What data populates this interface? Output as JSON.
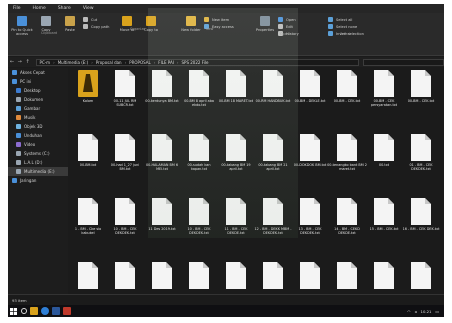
{
  "ribbon_tabs": [
    "File",
    "Home",
    "Share",
    "View"
  ],
  "ribbon": {
    "clipboard": {
      "pin": "Pin to Quick access",
      "copy": "Copy",
      "paste": "Paste",
      "cut": "Cut",
      "copy_path": "Copy path",
      "paste_shortcut": "Paste shortcut",
      "group": "Clipboard"
    },
    "organize": {
      "move_to": "Move to",
      "copy_to": "Copy to",
      "delete": "Delete",
      "rename": "Rename",
      "group": "Organize"
    },
    "new": {
      "new_folder": "New folder",
      "new_item": "New item",
      "easy_access": "Easy access",
      "group": "New"
    },
    "open": {
      "properties": "Properties",
      "open": "Open",
      "edit": "Edit",
      "history": "History",
      "group": "Open"
    },
    "select": {
      "select_all": "Select all",
      "select_none": "Select none",
      "invert": "Invert selection",
      "group": "Select"
    }
  },
  "address": {
    "crumbs": [
      "PC-m",
      "Multimedia (E:)",
      "Proposal dan",
      "PROPOSAL",
      "FILE PAI",
      "SPS 2022 File"
    ]
  },
  "sidebar": [
    {
      "label": "Akses Cepat",
      "sel": false,
      "indent": false,
      "color": "#4a90d9"
    },
    {
      "label": "PC ini",
      "sel": false,
      "indent": false,
      "color": "#4a90d9"
    },
    {
      "label": "Desktop",
      "sel": false,
      "indent": true,
      "color": "#3c7bd0"
    },
    {
      "label": "Dokumen",
      "sel": false,
      "indent": true,
      "color": "#9aa6b2"
    },
    {
      "label": "Gambar",
      "sel": false,
      "indent": true,
      "color": "#5ca0d8"
    },
    {
      "label": "Musik",
      "sel": false,
      "indent": true,
      "color": "#e08a3c"
    },
    {
      "label": "Objek 3D",
      "sel": false,
      "indent": true,
      "color": "#6fb3e0"
    },
    {
      "label": "Unduhan",
      "sel": false,
      "indent": true,
      "color": "#4a90d9"
    },
    {
      "label": "Video",
      "sel": false,
      "indent": true,
      "color": "#8c6cd0"
    },
    {
      "label": "Systems (C:)",
      "sel": false,
      "indent": true,
      "color": "#9aa6b2"
    },
    {
      "label": "L.A.L (D:)",
      "sel": false,
      "indent": true,
      "color": "#9aa6b2"
    },
    {
      "label": "Multimedia (E:)",
      "sel": true,
      "indent": true,
      "color": "#9aa6b2"
    },
    {
      "label": "Jaringan",
      "sel": false,
      "indent": false,
      "color": "#4a90d9"
    }
  ],
  "files": [
    {
      "label": "Kolom",
      "type": "folder"
    },
    {
      "label": "00-11 JUL RM SUBCR.txt",
      "type": "file"
    },
    {
      "label": "00-kerdunya BM.txt",
      "type": "file"
    },
    {
      "label": "00-BM 8 april aba ekdo.txt",
      "type": "file"
    },
    {
      "label": "00-BM 18 MARET.txt",
      "type": "file"
    },
    {
      "label": "00-RM HANDBUK.txt",
      "type": "file"
    },
    {
      "label": "00-BM - DEKLE.txt",
      "type": "file"
    },
    {
      "label": "00-BM - CEK.txt",
      "type": "file"
    },
    {
      "label": "00-BM - CEK persyaratan.txt",
      "type": "file"
    },
    {
      "label": "00-BM - CEK.txt",
      "type": "file"
    },
    {
      "label": "00-BM.txt",
      "type": "file"
    },
    {
      "label": "00-had 1_27 juni BM.txt",
      "type": "file"
    },
    {
      "label": "00-HALAMAN BM 6 MEI.txt",
      "type": "file"
    },
    {
      "label": "00-sudah kan kapan.txt",
      "type": "file"
    },
    {
      "label": "00-tabang BM 19 april.txt",
      "type": "file"
    },
    {
      "label": "00-tabang BM 21 april.txt",
      "type": "file"
    },
    {
      "label": "00-DOKDOK BM.txt",
      "type": "file"
    },
    {
      "label": "00-tenangko bant BM 2 maret.txt",
      "type": "file"
    },
    {
      "label": "00.txt",
      "type": "file"
    },
    {
      "label": "01 - BM - CEK DEKDEK.txt",
      "type": "file"
    },
    {
      "label": "1 - BM - Cke sio kabukel",
      "type": "file"
    },
    {
      "label": "10 - BM - CEK DEKDEK.txt",
      "type": "file"
    },
    {
      "label": "11 Des 2019.txt",
      "type": "file"
    },
    {
      "label": "10 - BM - CEK DEKDEK.txt",
      "type": "file"
    },
    {
      "label": "11 - BM - CEK DEKDE.txt",
      "type": "file"
    },
    {
      "label": "12 - BM - DEKK MBM - DEKDEK.txt",
      "type": "file"
    },
    {
      "label": "13 - BM - CEK DEKDEK.txt",
      "type": "file"
    },
    {
      "label": "14 - BM - CEKD DEKDE.txt",
      "type": "file"
    },
    {
      "label": "15 - BM - CEK.txt",
      "type": "file"
    },
    {
      "label": "16 - BM - CEK DEK.txt",
      "type": "file"
    },
    {
      "label": "",
      "type": "file"
    },
    {
      "label": "",
      "type": "file"
    },
    {
      "label": "",
      "type": "file"
    },
    {
      "label": "",
      "type": "file"
    },
    {
      "label": "",
      "type": "file"
    },
    {
      "label": "",
      "type": "file"
    },
    {
      "label": "",
      "type": "file"
    },
    {
      "label": "",
      "type": "file"
    },
    {
      "label": "",
      "type": "file"
    },
    {
      "label": "",
      "type": "file"
    }
  ],
  "status": {
    "count": "93 item"
  },
  "taskbar": {
    "time": "10.21"
  },
  "colors": {
    "folder": "#d9a21c",
    "background": "#1b1b1b",
    "accent": "#3c7bd0"
  }
}
